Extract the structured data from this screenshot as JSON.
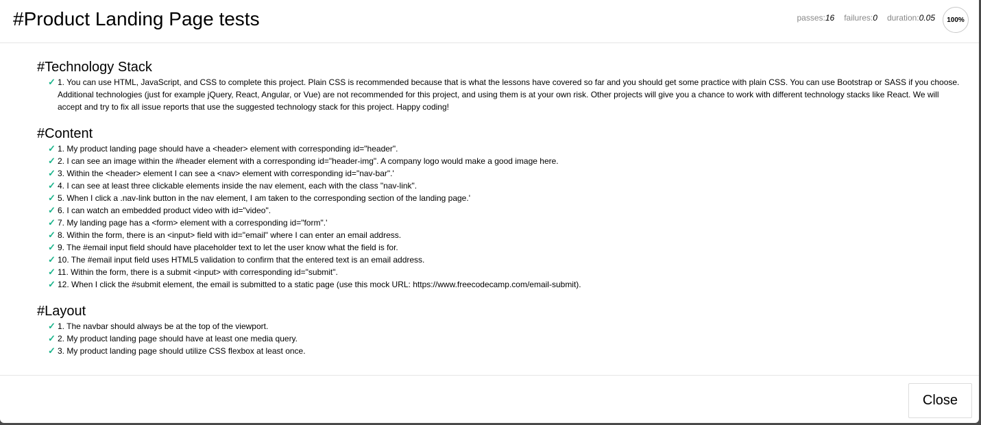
{
  "header": {
    "title": "#Product Landing Page tests",
    "stats": {
      "passes_label": "passes:",
      "passes_value": "16",
      "failures_label": "failures:",
      "failures_value": "0",
      "duration_label": "duration:",
      "duration_value": "0.05"
    },
    "progress": "100%"
  },
  "suites": [
    {
      "title": "#Technology Stack",
      "tests": [
        "1. You can use HTML, JavaScript, and CSS to complete this project. Plain CSS is recommended because that is what the lessons have covered so far and you should get some practice with plain CSS. You can use Bootstrap or SASS if you choose. Additional technologies (just for example jQuery, React, Angular, or Vue) are not recommended for this project, and using them is at your own risk. Other projects will give you a chance to work with different technology stacks like React. We will accept and try to fix all issue reports that use the suggested technology stack for this project. Happy coding!"
      ]
    },
    {
      "title": "#Content",
      "tests": [
        "1. My product landing page should have a <header> element with corresponding id=\"header\".",
        "2. I can see an image within the #header element with a corresponding id=\"header-img\". A company logo would make a good image here.",
        "3. Within the <header> element I can see a <nav> element with corresponding id=\"nav-bar\".'",
        "4. I can see at least three clickable elements inside the nav element, each with the class \"nav-link\".",
        "5. When I click a .nav-link button in the nav element, I am taken to the corresponding section of the landing page.'",
        "6. I can watch an embedded product video with id=\"video\".",
        "7. My landing page has a <form> element with a corresponding id=\"form\".'",
        "8. Within the form, there is an <input> field with id=\"email\" where I can enter an email address.",
        "9. The #email input field should have placeholder text to let the user know what the field is for.",
        "10. The #email input field uses HTML5 validation to confirm that the entered text is an email address.",
        "11. Within the form, there is a submit <input> with corresponding id=\"submit\".",
        "12. When I click the #submit element, the email is submitted to a static page (use this mock URL: https://www.freecodecamp.com/email-submit)."
      ]
    },
    {
      "title": "#Layout",
      "tests": [
        "1. The navbar should always be at the top of the viewport.",
        "2. My product landing page should have at least one media query.",
        "3. My product landing page should utilize CSS flexbox at least once."
      ]
    }
  ],
  "check_glyph": "✓",
  "footer": {
    "close_label": "Close"
  }
}
